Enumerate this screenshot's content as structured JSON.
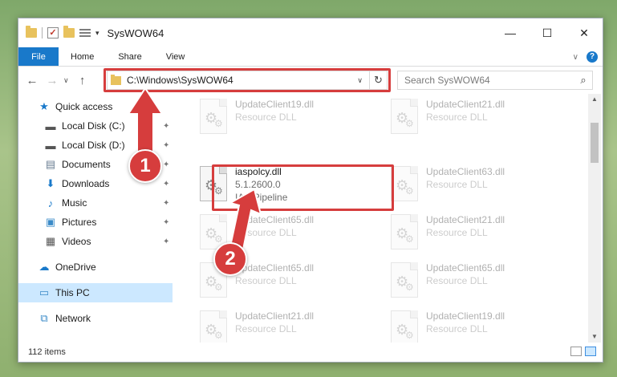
{
  "window": {
    "title": "SysWOW64"
  },
  "ribbon": {
    "tabs": [
      "File",
      "Home",
      "Share",
      "View"
    ],
    "help": "?"
  },
  "nav": {
    "back": "←",
    "forward": "→",
    "up": "↑",
    "recent": "∨"
  },
  "address": {
    "path": "C:\\Windows\\SysWOW64"
  },
  "search": {
    "placeholder": "Search SysWOW64"
  },
  "sidebar": {
    "items": [
      {
        "label": "Quick access",
        "icon": "star-icon"
      },
      {
        "label": "Local Disk (C:)",
        "icon": "drive-icon"
      },
      {
        "label": "Local Disk (D:)",
        "icon": "drive-icon"
      },
      {
        "label": "Documents",
        "icon": "documents-icon"
      },
      {
        "label": "Downloads",
        "icon": "downloads-icon"
      },
      {
        "label": "Music",
        "icon": "music-icon"
      },
      {
        "label": "Pictures",
        "icon": "pictures-icon"
      },
      {
        "label": "Videos",
        "icon": "videos-icon"
      },
      {
        "label": "OneDrive",
        "icon": "cloud-icon"
      },
      {
        "label": "This PC",
        "icon": "pc-icon"
      },
      {
        "label": "Network",
        "icon": "network-icon"
      }
    ]
  },
  "files": [
    {
      "name": "UpdateClient19.dll",
      "meta1": "Resource DLL"
    },
    {
      "name": "UpdateClient21.dll",
      "meta1": "Resource DLL"
    },
    {
      "name": "iaspolcy.dll",
      "meta1": "5.1.2600.0",
      "meta2": "IAS Pipeline"
    },
    {
      "name": "UpdateClient63.dll",
      "meta1": "Resource DLL"
    },
    {
      "name": "UpdateClient65.dll",
      "meta1": "Resource DLL"
    },
    {
      "name": "UpdateClient21.dll",
      "meta1": "Resource DLL"
    },
    {
      "name": "UpdateClient65.dll",
      "meta1": "Resource DLL"
    },
    {
      "name": "UpdateClient65.dll",
      "meta1": "Resource DLL"
    },
    {
      "name": "UpdateClient21.dll",
      "meta1": "Resource DLL"
    },
    {
      "name": "UpdateClient19.dll",
      "meta1": "Resource DLL"
    }
  ],
  "status": {
    "count": "112 items"
  },
  "callouts": {
    "one": "1",
    "two": "2"
  },
  "colors": {
    "highlight": "#d63d3d",
    "accent": "#1979ca",
    "selected": "#cce8ff"
  }
}
